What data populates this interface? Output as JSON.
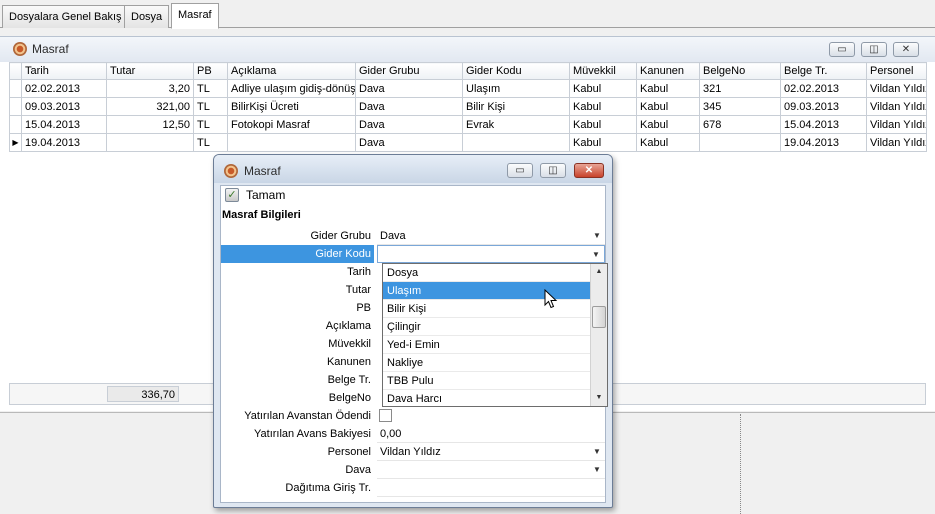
{
  "tabs": [
    {
      "label": "Dosyalara Genel Bakış",
      "active": false
    },
    {
      "label": "Dosya",
      "active": false
    },
    {
      "label": "Masraf",
      "active": true
    }
  ],
  "main": {
    "title": "Masraf",
    "window_buttons": {
      "minimize": "▭",
      "restore": "◫",
      "close": "✕"
    },
    "columns": [
      "Tarih",
      "Tutar",
      "PB",
      "Açıklama",
      "Gider Grubu",
      "Gider Kodu",
      "Müvekkil",
      "Kanunen",
      "BelgeNo",
      "Belge Tr.",
      "Personel"
    ],
    "rows": [
      [
        "02.02.2013",
        "3,20",
        "TL",
        "Adliye ulaşım gidiş-dönüş",
        "Dava",
        "Ulaşım",
        "Kabul",
        "Kabul",
        "321",
        "02.02.2013",
        "Vildan Yıldız"
      ],
      [
        "09.03.2013",
        "321,00",
        "TL",
        "BilirKişi Ücreti",
        "Dava",
        "Bilir Kişi",
        "Kabul",
        "Kabul",
        "345",
        "09.03.2013",
        "Vildan Yıldız"
      ],
      [
        "15.04.2013",
        "12,50",
        "TL",
        "Fotokopi Masraf",
        "Dava",
        "Evrak",
        "Kabul",
        "Kabul",
        "678",
        "15.04.2013",
        "Vildan Yıldız"
      ],
      [
        "19.04.2013",
        "",
        "TL",
        "",
        "Dava",
        "",
        "Kabul",
        "Kabul",
        "",
        "19.04.2013",
        "Vildan Yıldız"
      ]
    ],
    "current_row_marker": "▶",
    "total": "336,70"
  },
  "dialog": {
    "title": "Masraf",
    "window_buttons": {
      "minimize": "▭",
      "restore": "◫",
      "close": "✕"
    },
    "ok_label": "Tamam",
    "ok_check": "✓",
    "section_title": "Masraf Bilgileri",
    "combo_arrow": "▼",
    "fields": {
      "gider_grubu": {
        "label": "Gider Grubu",
        "value": "Dava"
      },
      "gider_kodu": {
        "label": "Gider Kodu",
        "value": ""
      },
      "tarih": {
        "label": "Tarih"
      },
      "tutar": {
        "label": "Tutar"
      },
      "pb": {
        "label": "PB"
      },
      "aciklama": {
        "label": "Açıklama"
      },
      "muvekkil": {
        "label": "Müvekkil"
      },
      "kanunen": {
        "label": "Kanunen"
      },
      "belge_tr": {
        "label": "Belge Tr."
      },
      "belge_no": {
        "label": "BelgeNo"
      },
      "yatirilan_avanstan": {
        "label": "Yatırılan Avanstan Ödendi",
        "checked": false
      },
      "yatirilan_avans_bakiyesi": {
        "label": "Yatırılan Avans Bakiyesi",
        "value": "0,00"
      },
      "personel": {
        "label": "Personel",
        "value": "Vildan Yıldız"
      },
      "dava": {
        "label": "Dava",
        "value": ""
      },
      "dagitima_giris": {
        "label": "Dağıtıma Giriş Tr.",
        "value": ""
      }
    },
    "dropdown": {
      "items": [
        "Dosya",
        "Ulaşım",
        "Bilir Kişi",
        "Çilingir",
        "Yed-i Emin",
        "Nakliye",
        "TBB Pulu",
        "Dava Harcı"
      ],
      "selected": "Ulaşım",
      "scroll_up": "▲",
      "scroll_down": "▼"
    }
  },
  "colors": {
    "selection": "#3d95e0",
    "title_gradient_top": "#e7eef7",
    "title_gradient_bottom": "#c9d6e6",
    "close_button": "#c8422b"
  }
}
